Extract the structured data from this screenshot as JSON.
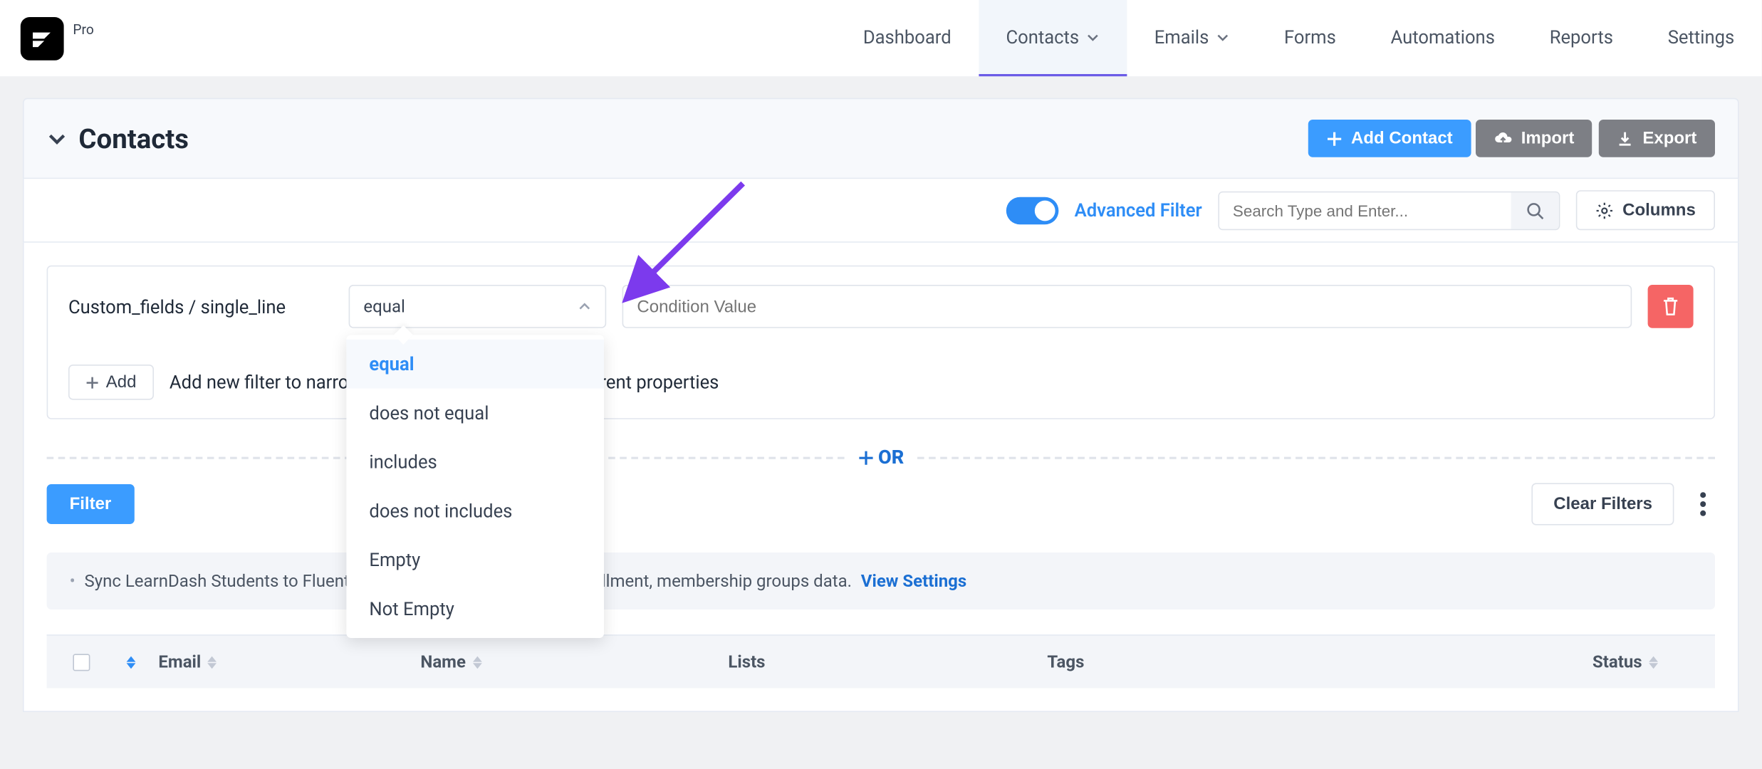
{
  "brand": {
    "tier": "Pro"
  },
  "nav": {
    "dashboard": "Dashboard",
    "contacts": "Contacts",
    "emails": "Emails",
    "forms": "Forms",
    "automations": "Automations",
    "reports": "Reports",
    "settings": "Settings"
  },
  "header": {
    "title": "Contacts",
    "add_contact": "Add Contact",
    "import": "Import",
    "export": "Export"
  },
  "toolbar": {
    "advanced_filter": "Advanced Filter",
    "search_placeholder": "Search Type and Enter...",
    "columns": "Columns"
  },
  "filter": {
    "field_label": "Custom_fields / single_line",
    "operator_value": "equal",
    "condition_placeholder": "Condition Value",
    "add_btn": "Add",
    "add_text": "Add new filter to narrow down your list based on different properties",
    "operators": {
      "equal": "equal",
      "not_equal": "does not equal",
      "includes": "includes",
      "not_includes": "does not includes",
      "empty": "Empty",
      "not_empty": "Not Empty"
    }
  },
  "or_label": "OR",
  "actions": {
    "filter": "Filter",
    "clear": "Clear Filters"
  },
  "notice": {
    "text": "Sync LearnDash Students to FluentCRM. Then segment by their enrollment, membership groups data. ",
    "link": "View Settings"
  },
  "table": {
    "email": "Email",
    "name": "Name",
    "lists": "Lists",
    "tags": "Tags",
    "status": "Status"
  }
}
